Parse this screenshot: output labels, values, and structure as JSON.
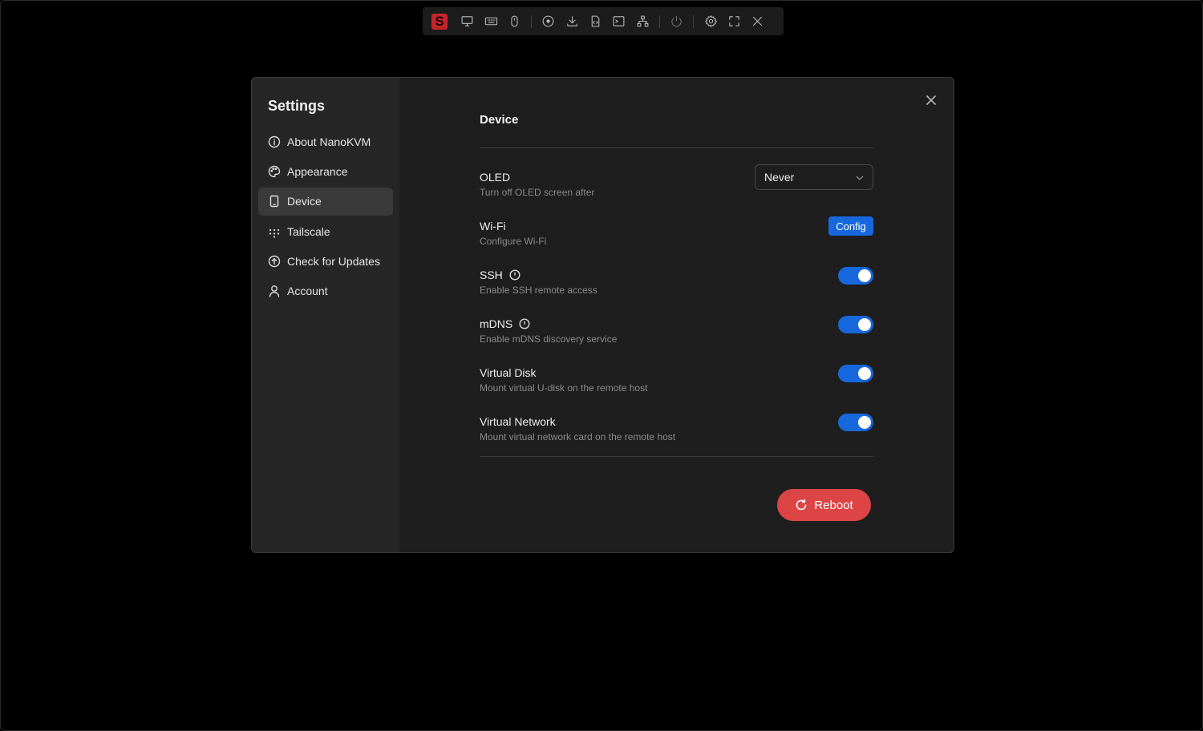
{
  "toolbar": {
    "logo_letter": "S",
    "icons": [
      "monitor-icon",
      "keyboard-icon",
      "mouse-icon",
      "disc-icon",
      "download-icon",
      "file-icon",
      "terminal-icon",
      "network-icon",
      "power-icon",
      "gear-icon",
      "fullscreen-icon",
      "close-icon"
    ]
  },
  "sidebar": {
    "title": "Settings",
    "items": [
      {
        "label": "About NanoKVM",
        "icon": "info-icon"
      },
      {
        "label": "Appearance",
        "icon": "palette-icon"
      },
      {
        "label": "Device",
        "icon": "phone-icon",
        "active": true
      },
      {
        "label": "Tailscale",
        "icon": "tailscale-icon"
      },
      {
        "label": "Check for Updates",
        "icon": "arrow-up-circle-icon"
      },
      {
        "label": "Account",
        "icon": "user-icon"
      }
    ]
  },
  "device": {
    "title": "Device",
    "oled": {
      "label": "OLED",
      "desc": "Turn off OLED screen after",
      "value": "Never"
    },
    "wifi": {
      "label": "Wi-Fi",
      "desc": "Configure Wi-Fi",
      "button": "Config"
    },
    "ssh": {
      "label": "SSH",
      "desc": "Enable SSH remote access",
      "enabled": true
    },
    "mdns": {
      "label": "mDNS",
      "desc": "Enable mDNS discovery service",
      "enabled": true
    },
    "virtual_disk": {
      "label": "Virtual Disk",
      "desc": "Mount virtual U-disk on the remote host",
      "enabled": true
    },
    "virtual_network": {
      "label": "Virtual Network",
      "desc": "Mount virtual network card on the remote host",
      "enabled": true
    },
    "reboot_label": "Reboot"
  },
  "colors": {
    "accent": "#1668dc",
    "danger": "#dc4446",
    "logo": "#c4252b",
    "background": "#000000",
    "modal": "#1e1e1e",
    "sidebar": "#262626"
  }
}
